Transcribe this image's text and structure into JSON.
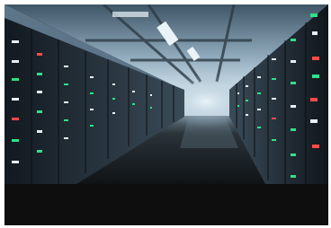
{
  "image": {
    "subject": "server-room-corridor",
    "palette": {
      "ceiling": "#9fb7c9",
      "floor": "#1b2126",
      "racks": "#1c232b",
      "led_green": "#2fe08a",
      "led_red": "#ff4a4a",
      "led_white": "#e8f0f5",
      "glow": "#cfe2ee"
    }
  },
  "caption_bar": {
    "color": "#0e0e0e"
  }
}
